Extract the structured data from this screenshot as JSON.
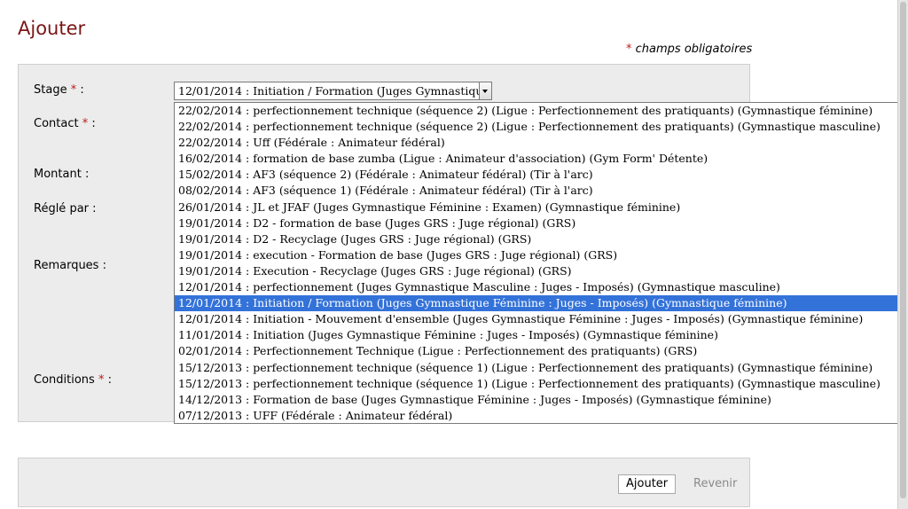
{
  "page": {
    "title": "Ajouter",
    "required_note": "champs obligatoires",
    "required_marker": "*"
  },
  "form": {
    "stage_label": "Stage",
    "contact_label": "Contact",
    "montant_label": "Montant :",
    "regle_label": "Réglé par :",
    "remarques_label": "Remarques :",
    "conditions_label": "Conditions",
    "colon": ":",
    "stage_value": "12/01/2014 : Initiation / Formation (Juges Gymnastique Féminine : Juges - Imposés) (Gymnastique féminine)"
  },
  "dropdown": {
    "options": [
      "22/02/2014 : perfectionnement technique (séquence 2) (Ligue : Perfectionnement des pratiquants) (Gymnastique féminine)",
      "22/02/2014 : perfectionnement technique (séquence 2) (Ligue : Perfectionnement des pratiquants) (Gymnastique masculine)",
      "22/02/2014 : Uff (Fédérale : Animateur fédéral)",
      "16/02/2014 : formation de base zumba (Ligue : Animateur d'association) (Gym Form' Détente)",
      "15/02/2014 : AF3 (séquence 2) (Fédérale : Animateur fédéral) (Tir à l'arc)",
      "08/02/2014 : AF3 (séquence 1) (Fédérale : Animateur fédéral) (Tir à l'arc)",
      "26/01/2014 : JL et JFAF (Juges Gymnastique Féminine : Examen) (Gymnastique féminine)",
      "19/01/2014 : D2 - formation de base (Juges GRS : Juge régional) (GRS)",
      "19/01/2014 : D2 - Recyclage (Juges GRS : Juge régional) (GRS)",
      "19/01/2014 : execution - Formation de base (Juges GRS : Juge régional) (GRS)",
      "19/01/2014 : Execution - Recyclage (Juges GRS : Juge régional) (GRS)",
      "12/01/2014 : perfectionnement (Juges Gymnastique Masculine : Juges - Imposés) (Gymnastique masculine)",
      "12/01/2014 : Initiation / Formation (Juges Gymnastique Féminine : Juges - Imposés) (Gymnastique féminine)",
      "12/01/2014 : Initiation - Mouvement d'ensemble (Juges Gymnastique Féminine : Juges - Imposés) (Gymnastique féminine)",
      "11/01/2014 : Initiation (Juges Gymnastique Féminine : Juges - Imposés) (Gymnastique féminine)",
      "02/01/2014 : Perfectionnement Technique (Ligue : Perfectionnement des pratiquants) (GRS)",
      "15/12/2013 : perfectionnement technique (séquence 1) (Ligue : Perfectionnement des pratiquants) (Gymnastique féminine)",
      "15/12/2013 : perfectionnement technique (séquence 1) (Ligue : Perfectionnement des pratiquants) (Gymnastique masculine)",
      "14/12/2013 : Formation de base (Juges Gymnastique Féminine : Juges - Imposés) (Gymnastique féminine)",
      "07/12/2013 : UFF (Fédérale : Animateur fédéral)"
    ],
    "selected_index": 12
  },
  "buttons": {
    "add_label": "Ajouter",
    "back_label": "Revenir"
  },
  "colors": {
    "title": "#7a1515",
    "required_star": "#c01818",
    "selection": "#3372d9"
  }
}
